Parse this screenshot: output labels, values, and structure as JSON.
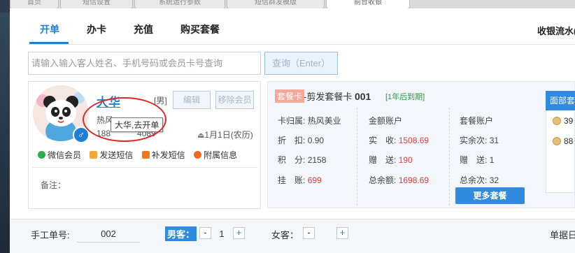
{
  "browser_tabs": [
    {
      "label": "首页",
      "active": false
    },
    {
      "label": "短信设置",
      "active": false
    },
    {
      "label": "系统运行参数",
      "active": false
    },
    {
      "label": "短信群发模版",
      "active": false
    },
    {
      "label": "前台收银",
      "active": true
    }
  ],
  "nav": {
    "tabs": [
      {
        "label": "开单",
        "active": true
      },
      {
        "label": "办卡",
        "active": false
      },
      {
        "label": "充值",
        "active": false
      },
      {
        "label": "购买套餐",
        "active": false
      }
    ],
    "cashier_link": "收银流水("
  },
  "search": {
    "placeholder": "请输入输入客人姓名、手机号码或会员卡号查询",
    "query_label": "查询（Enter）"
  },
  "customer": {
    "name": "大华",
    "gender": "[男]",
    "gender_symbol": "♂",
    "edit_label": "编辑",
    "remove_label": "移除会员",
    "store_partial": "热风",
    "phone_partial_start": "188",
    "phone_partial_end": "4089",
    "birthday": "1月1日(农历)",
    "tooltip": "大华,去开单",
    "actions": [
      {
        "label": "微信会员",
        "icon": "wechat-icon",
        "color": "#2bad4a"
      },
      {
        "label": "发送短信",
        "icon": "envelope-icon",
        "color": "#f0a93b"
      },
      {
        "label": "补发短信",
        "icon": "message-icon",
        "color": "#ef7a1e"
      },
      {
        "label": "附属信息",
        "icon": "info-icon",
        "color": "#ef6a1e"
      }
    ],
    "remark_label": "备注："
  },
  "package_card": {
    "tag": "套餐卡",
    "title": "-剪发套餐卡",
    "number": "001",
    "expire": "[1年后到期]",
    "store_info": "卡归属: 热风美业",
    "discount_label": "折　扣:",
    "discount_value": "0.90",
    "points_label": "积　分:",
    "points_value": "2158",
    "credit_label": "挂　账:",
    "credit_value": "699",
    "amount_title": "金额账户",
    "real_label": "实　收:",
    "real_value": "1508.69",
    "gift_label": "赠　送:",
    "gift_value": "190",
    "total_label": "总余额:",
    "total_value": "1698.69",
    "combo_title": "套餐账户",
    "real_times_label": "实余次:",
    "real_times_value": "31",
    "gift_times_label": "赠　送:",
    "gift_times_value": "1",
    "total_times_label": "总余次:",
    "total_times_value": "32",
    "more_label": "更多套餐"
  },
  "face_panel": {
    "title": "面部套",
    "items": [
      "39",
      "88"
    ]
  },
  "bottom": {
    "bill_label": "手工单号:",
    "bill_value": "002",
    "male_label": "男客：",
    "male_count": "1",
    "female_label": "女客：",
    "female_count": "",
    "date_label": "单据日"
  }
}
